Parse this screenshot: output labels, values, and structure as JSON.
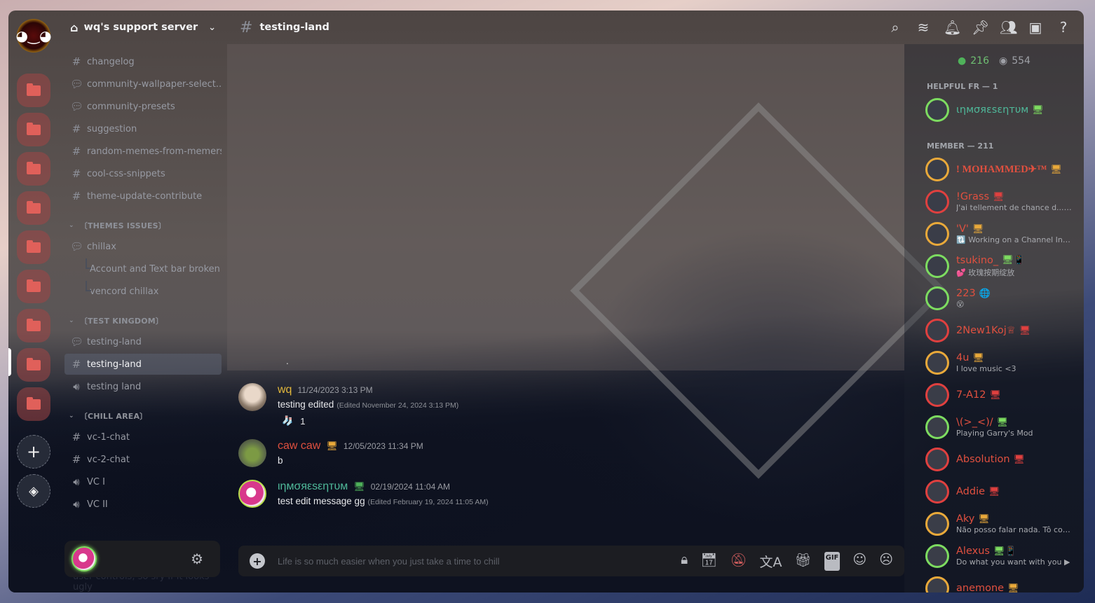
{
  "server": {
    "name": "wq's support server",
    "rail_folder_count": 9,
    "add_label": "+",
    "discover_label": "⊘"
  },
  "sidebar": {
    "channels_top": [
      {
        "type": "text",
        "label": "changelog"
      },
      {
        "type": "forum",
        "label": "community-wallpaper-select..."
      },
      {
        "type": "forum",
        "label": "community-presets"
      },
      {
        "type": "text",
        "label": "suggestion"
      },
      {
        "type": "text",
        "label": "random-memes-from-memers"
      },
      {
        "type": "text",
        "label": "cool-css-snippets"
      },
      {
        "type": "text",
        "label": "theme-update-contribute"
      }
    ],
    "cat_themes": "〔THEMES ISSUES〕",
    "themes": {
      "forum": "chillax",
      "threads": [
        "Account and Text bar broken",
        "vencord chillax"
      ]
    },
    "cat_test": "〔TEST KINGDOM〕",
    "test": [
      {
        "type": "forum",
        "label": "testing-land"
      },
      {
        "type": "text",
        "label": "testing-land",
        "active": true
      },
      {
        "type": "voice",
        "label": "testing land"
      }
    ],
    "cat_chill": "〔CHILL AREA〕",
    "chill": [
      {
        "type": "text",
        "label": "vc-1-chat"
      },
      {
        "type": "text",
        "label": "vc-2-chat"
      },
      {
        "type": "voice",
        "label": "VC I"
      },
      {
        "type": "voice",
        "label": "VC II"
      }
    ],
    "gap_note": "this big gap is for the floating user controls, so sry if it looks ugly"
  },
  "chat": {
    "channel": "testing-land",
    "placeholder": "Life is so much easier when you just take a time to chill",
    "dot": ".",
    "messages": [
      {
        "user": "wq",
        "color": "#e3b83c",
        "time": "11/24/2023 3:13 PM",
        "text": "testing edited",
        "edited": "(Edited November 24, 2024 3:13 PM)",
        "reaction": {
          "emoji": "🧦",
          "count": "1"
        }
      },
      {
        "user": "caw caw",
        "color": "#e0503f",
        "device": "desktop",
        "time": "12/05/2023 11:34 PM",
        "text": "b"
      },
      {
        "user": "ιηмσяεѕεηтυм",
        "color": "#4fb99a",
        "device": "desktop",
        "time": "02/19/2024 11:04 AM",
        "text": "test edit message gg",
        "edited": "(Edited February 19, 2024 11:05 AM)"
      }
    ]
  },
  "members": {
    "online": "216",
    "offline": "554",
    "group1": "HELPFUL FR — 1",
    "group2": "MEMBER — 211",
    "list": [
      {
        "name": "ιηмσяεѕεηтυм",
        "color": "#4fb99a",
        "ring": "#7ddc60",
        "status": "",
        "device": "🖥"
      },
      {
        "name": "! MOHAMMED✈™",
        "color": "#e0503f",
        "ring": "#e9a93a",
        "status": "",
        "device": "🖥"
      },
      {
        "name": "!Grass",
        "color": "#e0503f",
        "ring": "#e0403f",
        "status": "J'ai tellement de chance d... ▶",
        "device": "🖥"
      },
      {
        "name": "'V'",
        "color": "#e0503f",
        "ring": "#e9a93a",
        "status": "🔃 Working on a Channel Intr...",
        "device": "🖥"
      },
      {
        "name": "tsukino_",
        "color": "#e0503f",
        "ring": "#7ddc60",
        "status": "💕 玫瑰按期绽放",
        "device": "🖥📱"
      },
      {
        "name": "223",
        "color": "#e0503f",
        "ring": "#7ddc60",
        "status": "😵",
        "device": "🌐"
      },
      {
        "name": "2New1Koj♕",
        "color": "#e0503f",
        "ring": "#e0403f",
        "status": "",
        "device": "🖥"
      },
      {
        "name": "4u",
        "color": "#e0503f",
        "ring": "#e9a93a",
        "status": "I love music <3",
        "device": "🖥"
      },
      {
        "name": "7-A12",
        "color": "#e0503f",
        "ring": "#e0403f",
        "status": "",
        "device": "🖥"
      },
      {
        "name": "\\(>_<)/",
        "color": "#e0503f",
        "ring": "#7ddc60",
        "status": "Playing Garry's Mod",
        "device": "🖥"
      },
      {
        "name": "Absolution",
        "color": "#e0503f",
        "ring": "#e0403f",
        "status": "",
        "device": "🖥"
      },
      {
        "name": "Addie",
        "color": "#e0503f",
        "ring": "#e0403f",
        "status": "",
        "device": "🖥"
      },
      {
        "name": "Aky",
        "color": "#e0503f",
        "ring": "#e9a93a",
        "status": "Não posso falar nada. Tô com ...",
        "device": "🖥"
      },
      {
        "name": "Alexus",
        "color": "#e0503f",
        "ring": "#7ddc60",
        "status": "Do what you want with you ▶",
        "device": "🖥📱"
      },
      {
        "name": "anemone",
        "color": "#e0503f",
        "ring": "#e9a93a",
        "status": "",
        "device": "🖥"
      }
    ]
  }
}
